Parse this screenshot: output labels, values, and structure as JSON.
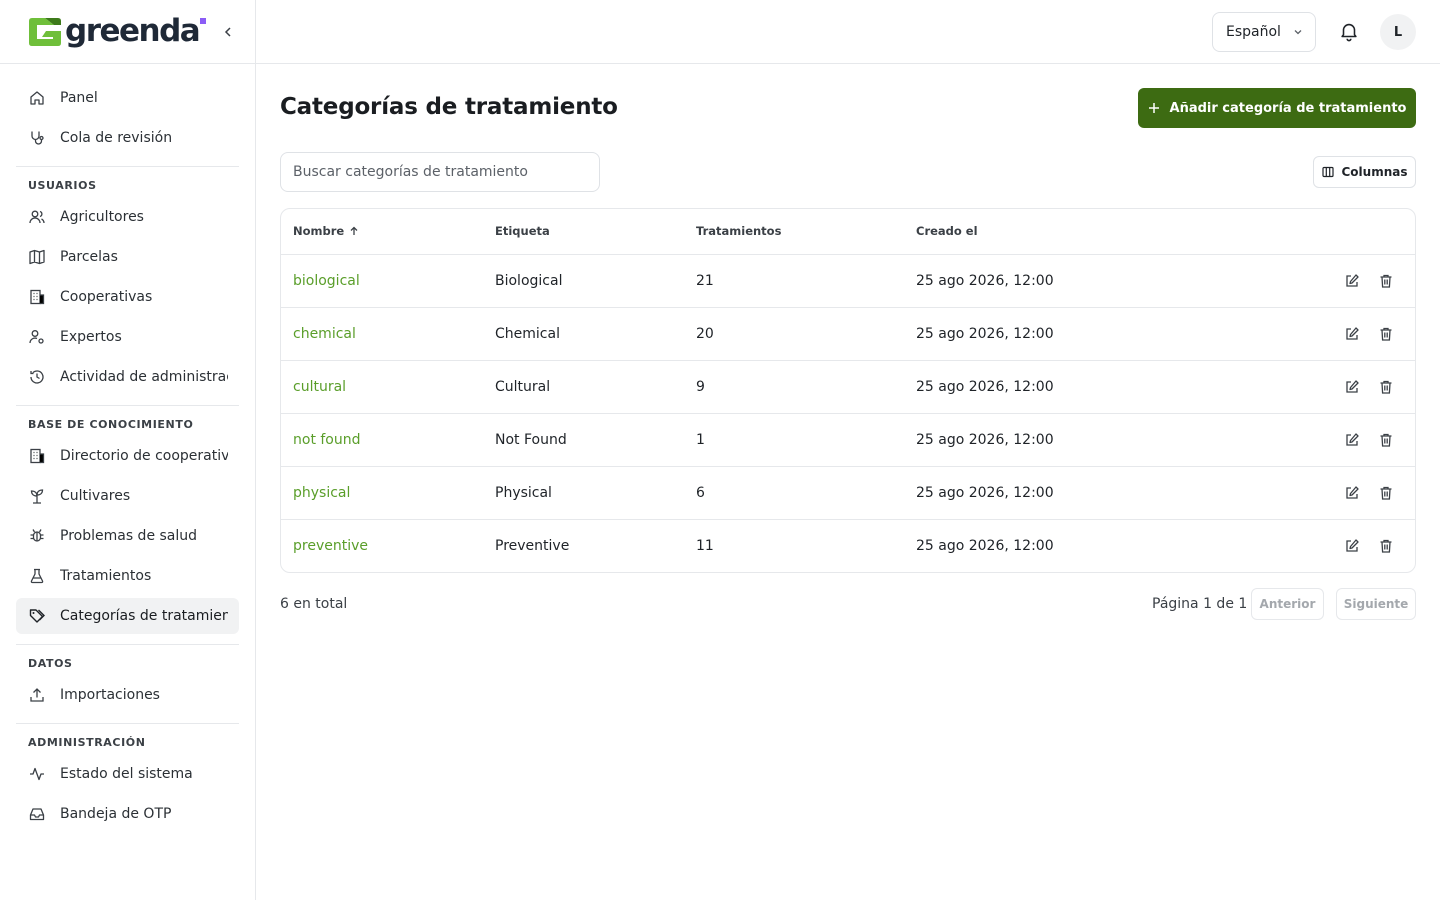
{
  "brand": {
    "name": "greenda"
  },
  "sidebar": {
    "top_items": [
      {
        "label": "Panel",
        "icon": "home-icon"
      },
      {
        "label": "Cola de revisión",
        "icon": "stethoscope-icon"
      }
    ],
    "sections": [
      {
        "title": "USUARIOS",
        "items": [
          {
            "label": "Agricultores",
            "icon": "users-icon"
          },
          {
            "label": "Parcelas",
            "icon": "map-icon"
          },
          {
            "label": "Cooperativas",
            "icon": "building-icon"
          },
          {
            "label": "Expertos",
            "icon": "user-cog-icon"
          },
          {
            "label": "Actividad de administración",
            "icon": "history-icon"
          }
        ]
      },
      {
        "title": "BASE DE CONOCIMIENTO",
        "items": [
          {
            "label": "Directorio de cooperativas",
            "icon": "building-icon"
          },
          {
            "label": "Cultivares",
            "icon": "sprout-icon"
          },
          {
            "label": "Problemas de salud",
            "icon": "bug-icon"
          },
          {
            "label": "Tratamientos",
            "icon": "flask-icon"
          },
          {
            "label": "Categorías de tratamiento",
            "icon": "tags-icon",
            "active": true
          }
        ]
      },
      {
        "title": "DATOS",
        "items": [
          {
            "label": "Importaciones",
            "icon": "upload-icon"
          }
        ]
      },
      {
        "title": "ADMINISTRACIÓN",
        "items": [
          {
            "label": "Estado del sistema",
            "icon": "activity-icon"
          },
          {
            "label": "Bandeja de OTP",
            "icon": "inbox-icon"
          }
        ]
      }
    ]
  },
  "topbar": {
    "language": "Español",
    "avatar_initial": "L"
  },
  "page": {
    "title": "Categorías de tratamiento",
    "add_button": "Añadir categoría de tratamiento",
    "search_placeholder": "Buscar categorías de tratamiento",
    "columns_button": "Columnas"
  },
  "table": {
    "headers": [
      "Nombre",
      "Etiqueta",
      "Tratamientos",
      "Creado el"
    ],
    "rows": [
      {
        "name": "biological",
        "label": "Biological",
        "treatments": "21",
        "created": "25 ago 2026, 12:00"
      },
      {
        "name": "chemical",
        "label": "Chemical",
        "treatments": "20",
        "created": "25 ago 2026, 12:00"
      },
      {
        "name": "cultural",
        "label": "Cultural",
        "treatments": "9",
        "created": "25 ago 2026, 12:00"
      },
      {
        "name": "not found",
        "label": "Not Found",
        "treatments": "1",
        "created": "25 ago 2026, 12:00"
      },
      {
        "name": "physical",
        "label": "Physical",
        "treatments": "6",
        "created": "25 ago 2026, 12:00"
      },
      {
        "name": "preventive",
        "label": "Preventive",
        "treatments": "11",
        "created": "25 ago 2026, 12:00"
      }
    ]
  },
  "footer": {
    "total": "6 en total",
    "page_info": "Página 1 de 1",
    "prev": "Anterior",
    "next": "Siguiente"
  },
  "colors": {
    "primary": "#3d6b12",
    "link": "#5a9e2a",
    "logo_accent": "#8b5cf6"
  }
}
